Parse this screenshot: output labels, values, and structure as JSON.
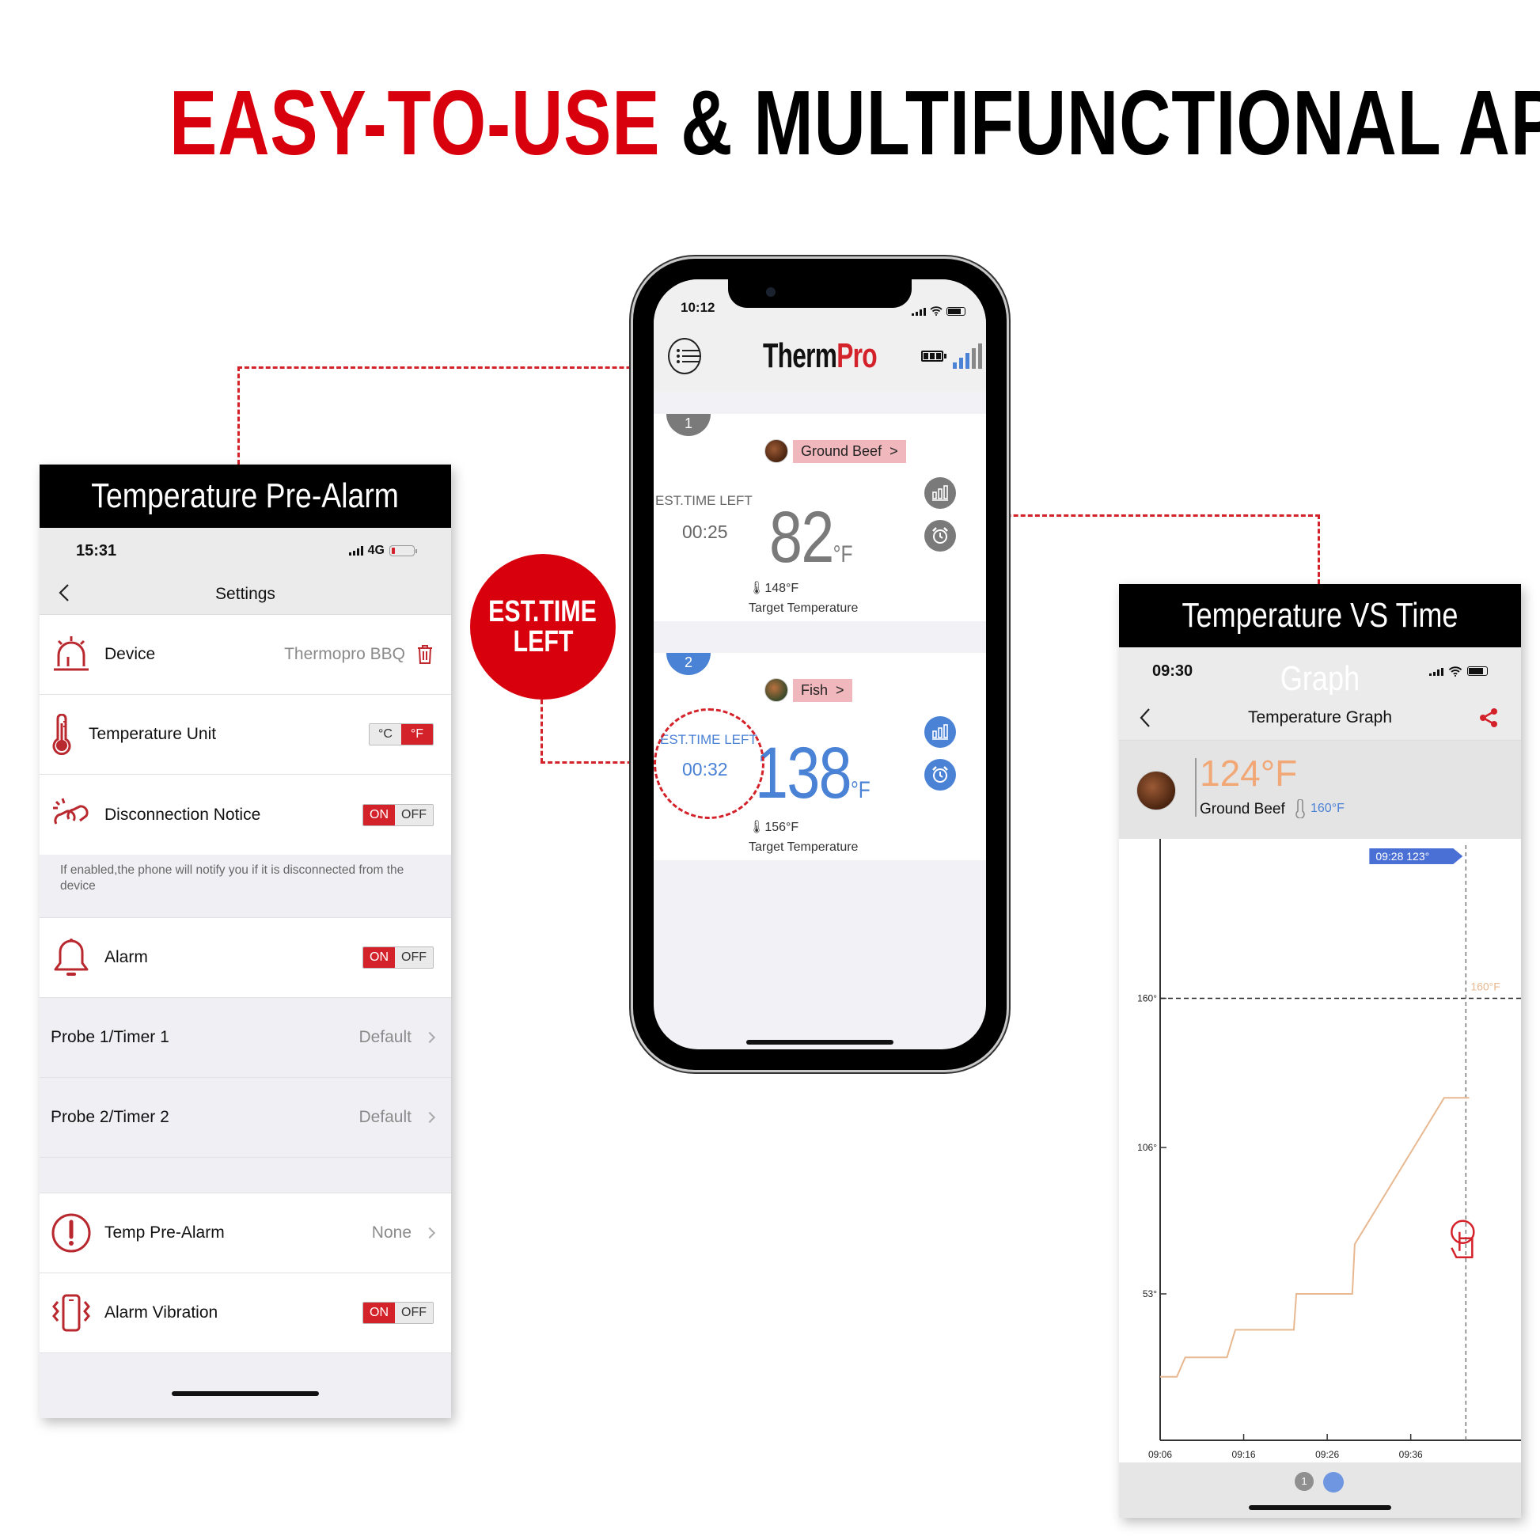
{
  "headline": {
    "part1": "EASY-TO-USE",
    "part2": "& MULTIFUNCTIONAL APP"
  },
  "callout": {
    "line1": "EST.TIME",
    "line2": "LEFT"
  },
  "left_panel": {
    "title": "Temperature Pre-Alarm",
    "status": {
      "time": "15:31",
      "network": "4G"
    },
    "nav": {
      "title": "Settings"
    },
    "rows": {
      "device": {
        "label": "Device",
        "value": "Thermopro BBQ"
      },
      "temp_unit": {
        "label": "Temperature Unit",
        "options": [
          "°C",
          "°F"
        ],
        "selected": "°F"
      },
      "disconnection": {
        "label": "Disconnection Notice",
        "on": "ON",
        "off": "OFF",
        "state": "ON"
      },
      "disconnection_note": "If enabled,the phone will notify you if it is disconnected from the device",
      "alarm": {
        "label": "Alarm",
        "on": "ON",
        "off": "OFF",
        "state": "ON"
      },
      "probe1": {
        "label": "Probe 1/Timer 1",
        "value": "Default"
      },
      "probe2": {
        "label": "Probe 2/Timer 2",
        "value": "Default"
      },
      "pre_alarm": {
        "label": "Temp Pre-Alarm",
        "value": "None"
      },
      "vibration": {
        "label": "Alarm Vibration",
        "on": "ON",
        "off": "OFF",
        "state": "ON"
      }
    }
  },
  "phone": {
    "status": {
      "time": "10:12"
    },
    "logo": {
      "part1": "Therm",
      "part2": "Pro"
    },
    "probes": [
      {
        "number": "1",
        "food": "Ground Beef",
        "est_label": "EST.TIME LEFT",
        "est_value": "00:25",
        "temp": "82",
        "unit": "°F",
        "target": "148°F",
        "target_label": "Target Temperature",
        "color": "#7a7a7a"
      },
      {
        "number": "2",
        "food": "Fish",
        "est_label": "EST.TIME LEFT",
        "est_value": "00:32",
        "temp": "138",
        "unit": "°F",
        "target": "156°F",
        "target_label": "Target Temperature",
        "color": "#4a82d6"
      }
    ]
  },
  "right_panel": {
    "title": "Temperature VS Time Graph",
    "status": {
      "time": "09:30"
    },
    "nav": {
      "title": "Temperature Graph"
    },
    "info": {
      "current": "124°F",
      "food": "Ground Beef",
      "target": "160°F"
    },
    "pager": {
      "page1": "1"
    }
  },
  "chart_data": {
    "type": "line",
    "title": "Temperature Graph",
    "xlabel": "",
    "ylabel": "",
    "x_ticks": [
      "09:06",
      "09:16",
      "09:26",
      "09:36"
    ],
    "y_ticks": [
      "53°",
      "106°",
      "160°"
    ],
    "y_tick_values": [
      53,
      106,
      160
    ],
    "x_minutes_range": [
      0,
      36
    ],
    "ylim": [
      0,
      212
    ],
    "target_line": {
      "value": 160,
      "label": "160°F"
    },
    "tooltip": {
      "time": "09:28",
      "value": "123°",
      "text": "09:28  123°"
    },
    "cursor_minute": 36.6,
    "series": [
      {
        "name": "Ground Beef",
        "color": "#e8b890",
        "points": [
          [
            0,
            23
          ],
          [
            2,
            23
          ],
          [
            3,
            30
          ],
          [
            8,
            30
          ],
          [
            9,
            40
          ],
          [
            16,
            40
          ],
          [
            16.3,
            53
          ],
          [
            23,
            53
          ],
          [
            23.3,
            71
          ],
          [
            34,
            124
          ],
          [
            37,
            124
          ]
        ]
      }
    ]
  },
  "colors": {
    "accent_red": "#d4222a",
    "brand_red": "#d9000d",
    "probe_blue": "#4a82d6",
    "probe_gray": "#7a7a7a",
    "series": "#e8b890",
    "tooltip": "#4a70d6"
  }
}
